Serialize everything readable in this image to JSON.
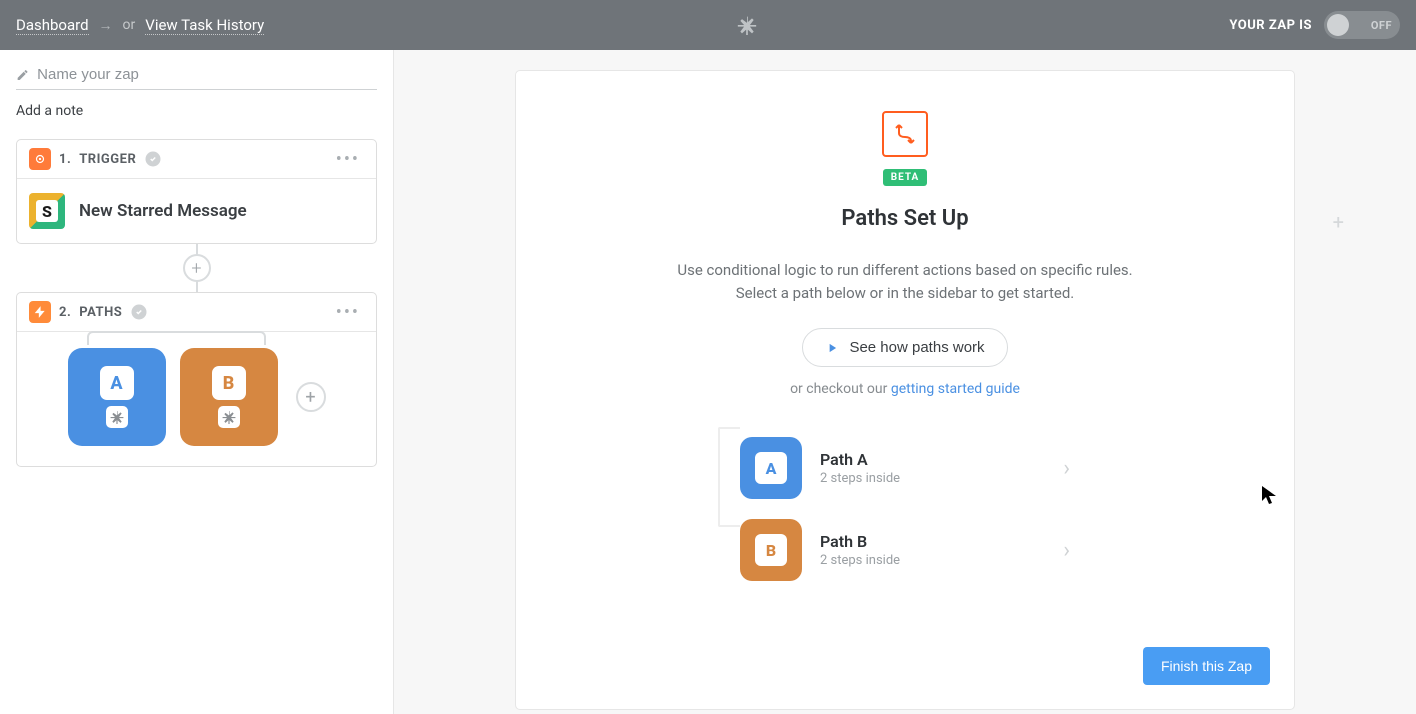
{
  "header": {
    "dashboard": "Dashboard",
    "or": "or",
    "task_history": "View Task History",
    "your_zap": "YOUR ZAP IS",
    "toggle_state": "OFF"
  },
  "sidebar": {
    "name_placeholder": "Name your zap",
    "add_note": "Add a note",
    "steps": [
      {
        "number": "1.",
        "label": "TRIGGER",
        "body_text": "New Starred Message",
        "app": "slack"
      },
      {
        "number": "2.",
        "label": "PATHS"
      }
    ],
    "paths_tiles": [
      {
        "letter": "A",
        "color": "a"
      },
      {
        "letter": "B",
        "color": "b"
      }
    ]
  },
  "panel": {
    "beta": "BETA",
    "title": "Paths Set Up",
    "desc_line1": "Use conditional logic to run different actions based on specific rules.",
    "desc_line2": "Select a path below or in the sidebar to get started.",
    "how_button": "See how paths work",
    "guide_prefix": "or checkout our ",
    "guide_link": "getting started guide",
    "paths": [
      {
        "letter": "A",
        "name": "Path A",
        "steps": "2 steps inside",
        "color": "a"
      },
      {
        "letter": "B",
        "name": "Path B",
        "steps": "2 steps inside",
        "color": "b"
      }
    ],
    "finish": "Finish this Zap"
  }
}
